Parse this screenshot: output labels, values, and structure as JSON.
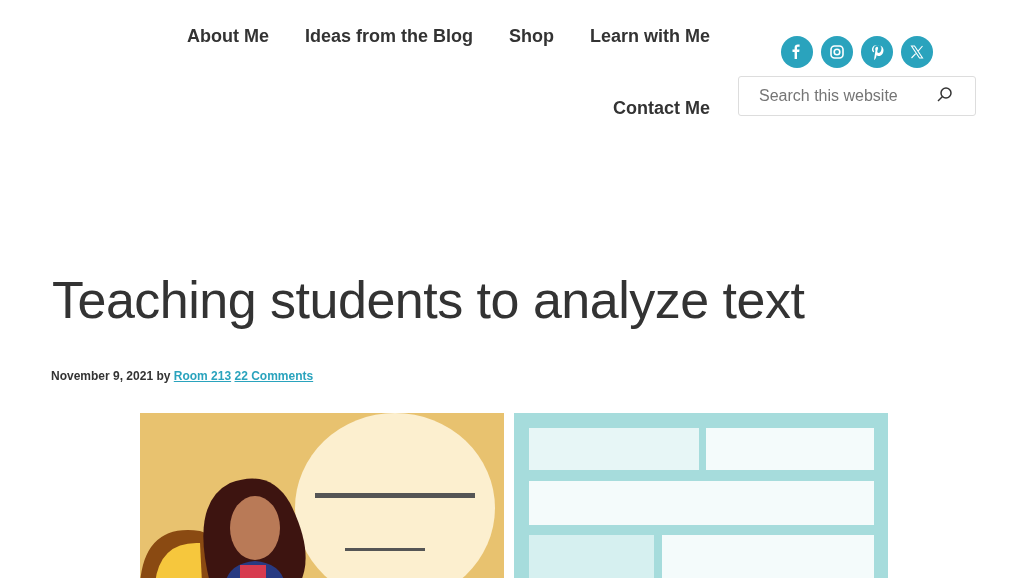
{
  "nav": {
    "items": [
      {
        "label": "About Me"
      },
      {
        "label": "Ideas from the Blog"
      },
      {
        "label": "Shop"
      },
      {
        "label": "Learn with Me"
      },
      {
        "label": "Contact Me"
      }
    ]
  },
  "social": [
    {
      "kind": "facebook"
    },
    {
      "kind": "instagram"
    },
    {
      "kind": "pinterest"
    },
    {
      "kind": "x"
    }
  ],
  "search": {
    "placeholder": "Search this website"
  },
  "post": {
    "title": "Teaching students to analyze text",
    "date": "November 9, 2021",
    "by": "by",
    "author": "Room 213",
    "comments": "22 Comments"
  }
}
